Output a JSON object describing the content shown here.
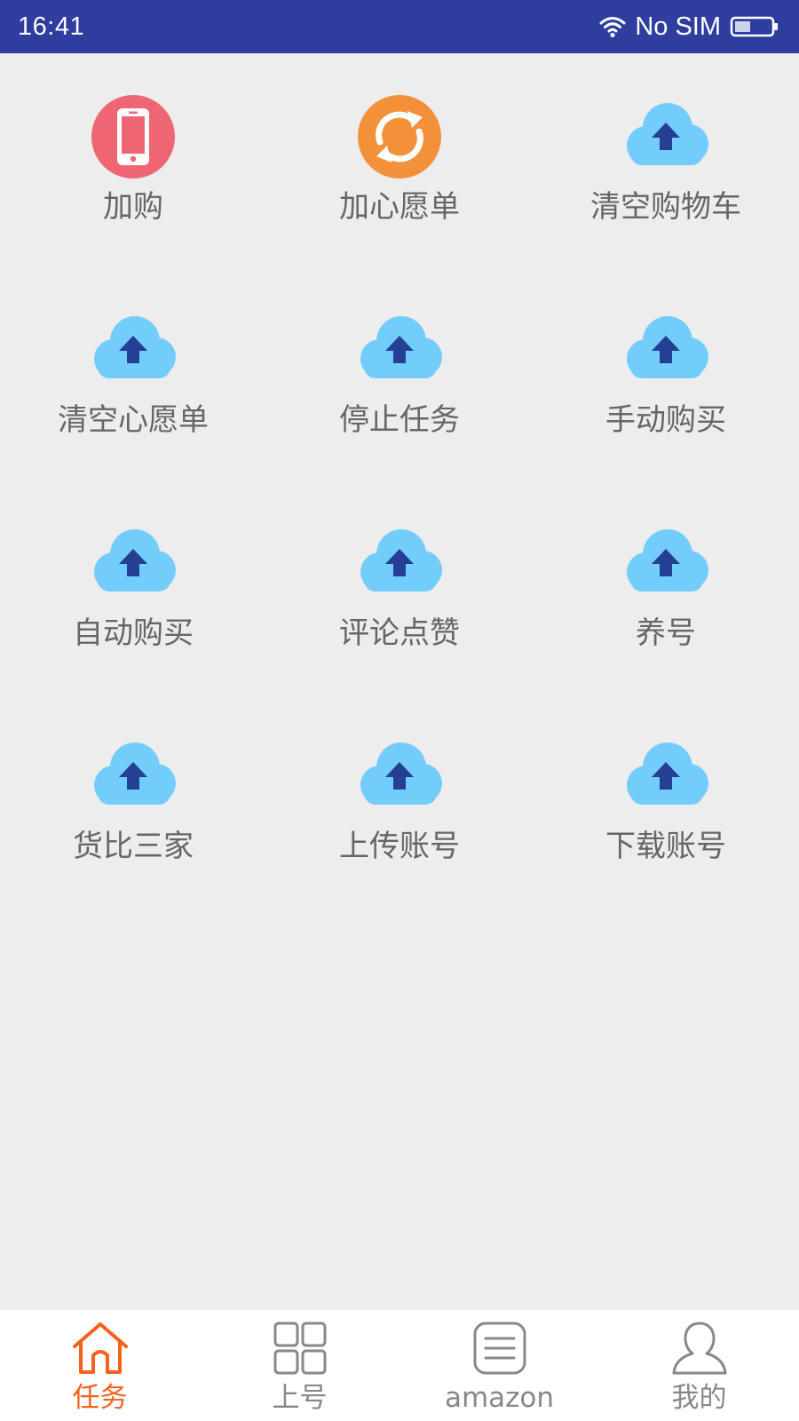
{
  "status_bar": {
    "time": "16:41",
    "carrier": "No SIM"
  },
  "colors": {
    "status_bar_bg": "#2f3e9e",
    "active_tab": "#f4621e",
    "inactive_tab": "#888888",
    "cloud": "#73cdfb",
    "cloud_arrow": "#243f94",
    "phone_badge": "#ee6673",
    "sync_badge": "#f2913a"
  },
  "grid": {
    "items": [
      {
        "label": "加购",
        "icon": "phone-icon"
      },
      {
        "label": "加心愿单",
        "icon": "sync-icon"
      },
      {
        "label": "清空购物车",
        "icon": "cloud-upload-icon"
      },
      {
        "label": "清空心愿单",
        "icon": "cloud-upload-icon"
      },
      {
        "label": "停止任务",
        "icon": "cloud-upload-icon"
      },
      {
        "label": "手动购买",
        "icon": "cloud-upload-icon"
      },
      {
        "label": "自动购买",
        "icon": "cloud-upload-icon"
      },
      {
        "label": "评论点赞",
        "icon": "cloud-upload-icon"
      },
      {
        "label": "养号",
        "icon": "cloud-upload-icon"
      },
      {
        "label": "货比三家",
        "icon": "cloud-upload-icon"
      },
      {
        "label": "上传账号",
        "icon": "cloud-upload-icon"
      },
      {
        "label": "下载账号",
        "icon": "cloud-upload-icon"
      }
    ]
  },
  "tabs": [
    {
      "label": "任务",
      "icon": "home-icon",
      "active": true
    },
    {
      "label": "上号",
      "icon": "grid-icon",
      "active": false
    },
    {
      "label": "amazon",
      "icon": "list-icon",
      "active": false
    },
    {
      "label": "我的",
      "icon": "user-icon",
      "active": false
    }
  ]
}
